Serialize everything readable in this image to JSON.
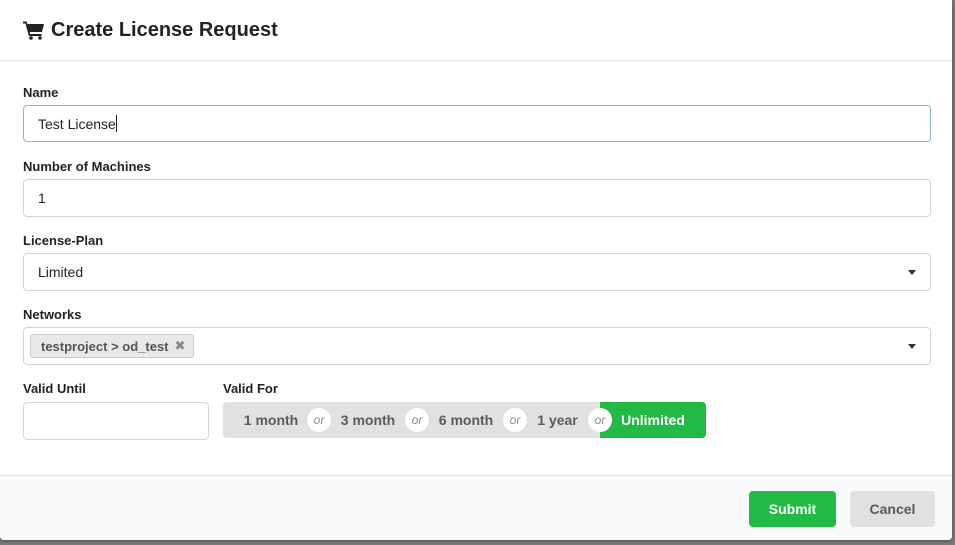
{
  "dialog": {
    "title": "Create License Request",
    "icon": "shopping-cart-icon"
  },
  "form": {
    "name": {
      "label": "Name",
      "value": "Test License"
    },
    "machines": {
      "label": "Number of Machines",
      "value": "1"
    },
    "plan": {
      "label": "License-Plan",
      "value": "Limited"
    },
    "networks": {
      "label": "Networks",
      "chips": [
        "testproject > od_test"
      ],
      "chip_remove_glyph": "✖"
    },
    "valid_until": {
      "label": "Valid Until",
      "value": ""
    },
    "valid_for": {
      "label": "Valid For",
      "options": [
        "1 month",
        "3 month",
        "6 month",
        "1 year",
        "Unlimited"
      ],
      "separator": "or",
      "selected": "Unlimited"
    }
  },
  "actions": {
    "submit": "Submit",
    "cancel": "Cancel"
  },
  "colors": {
    "primary_green": "#21ba45",
    "focus_border": "#85b7d9",
    "button_grey": "#e0e1e2"
  }
}
